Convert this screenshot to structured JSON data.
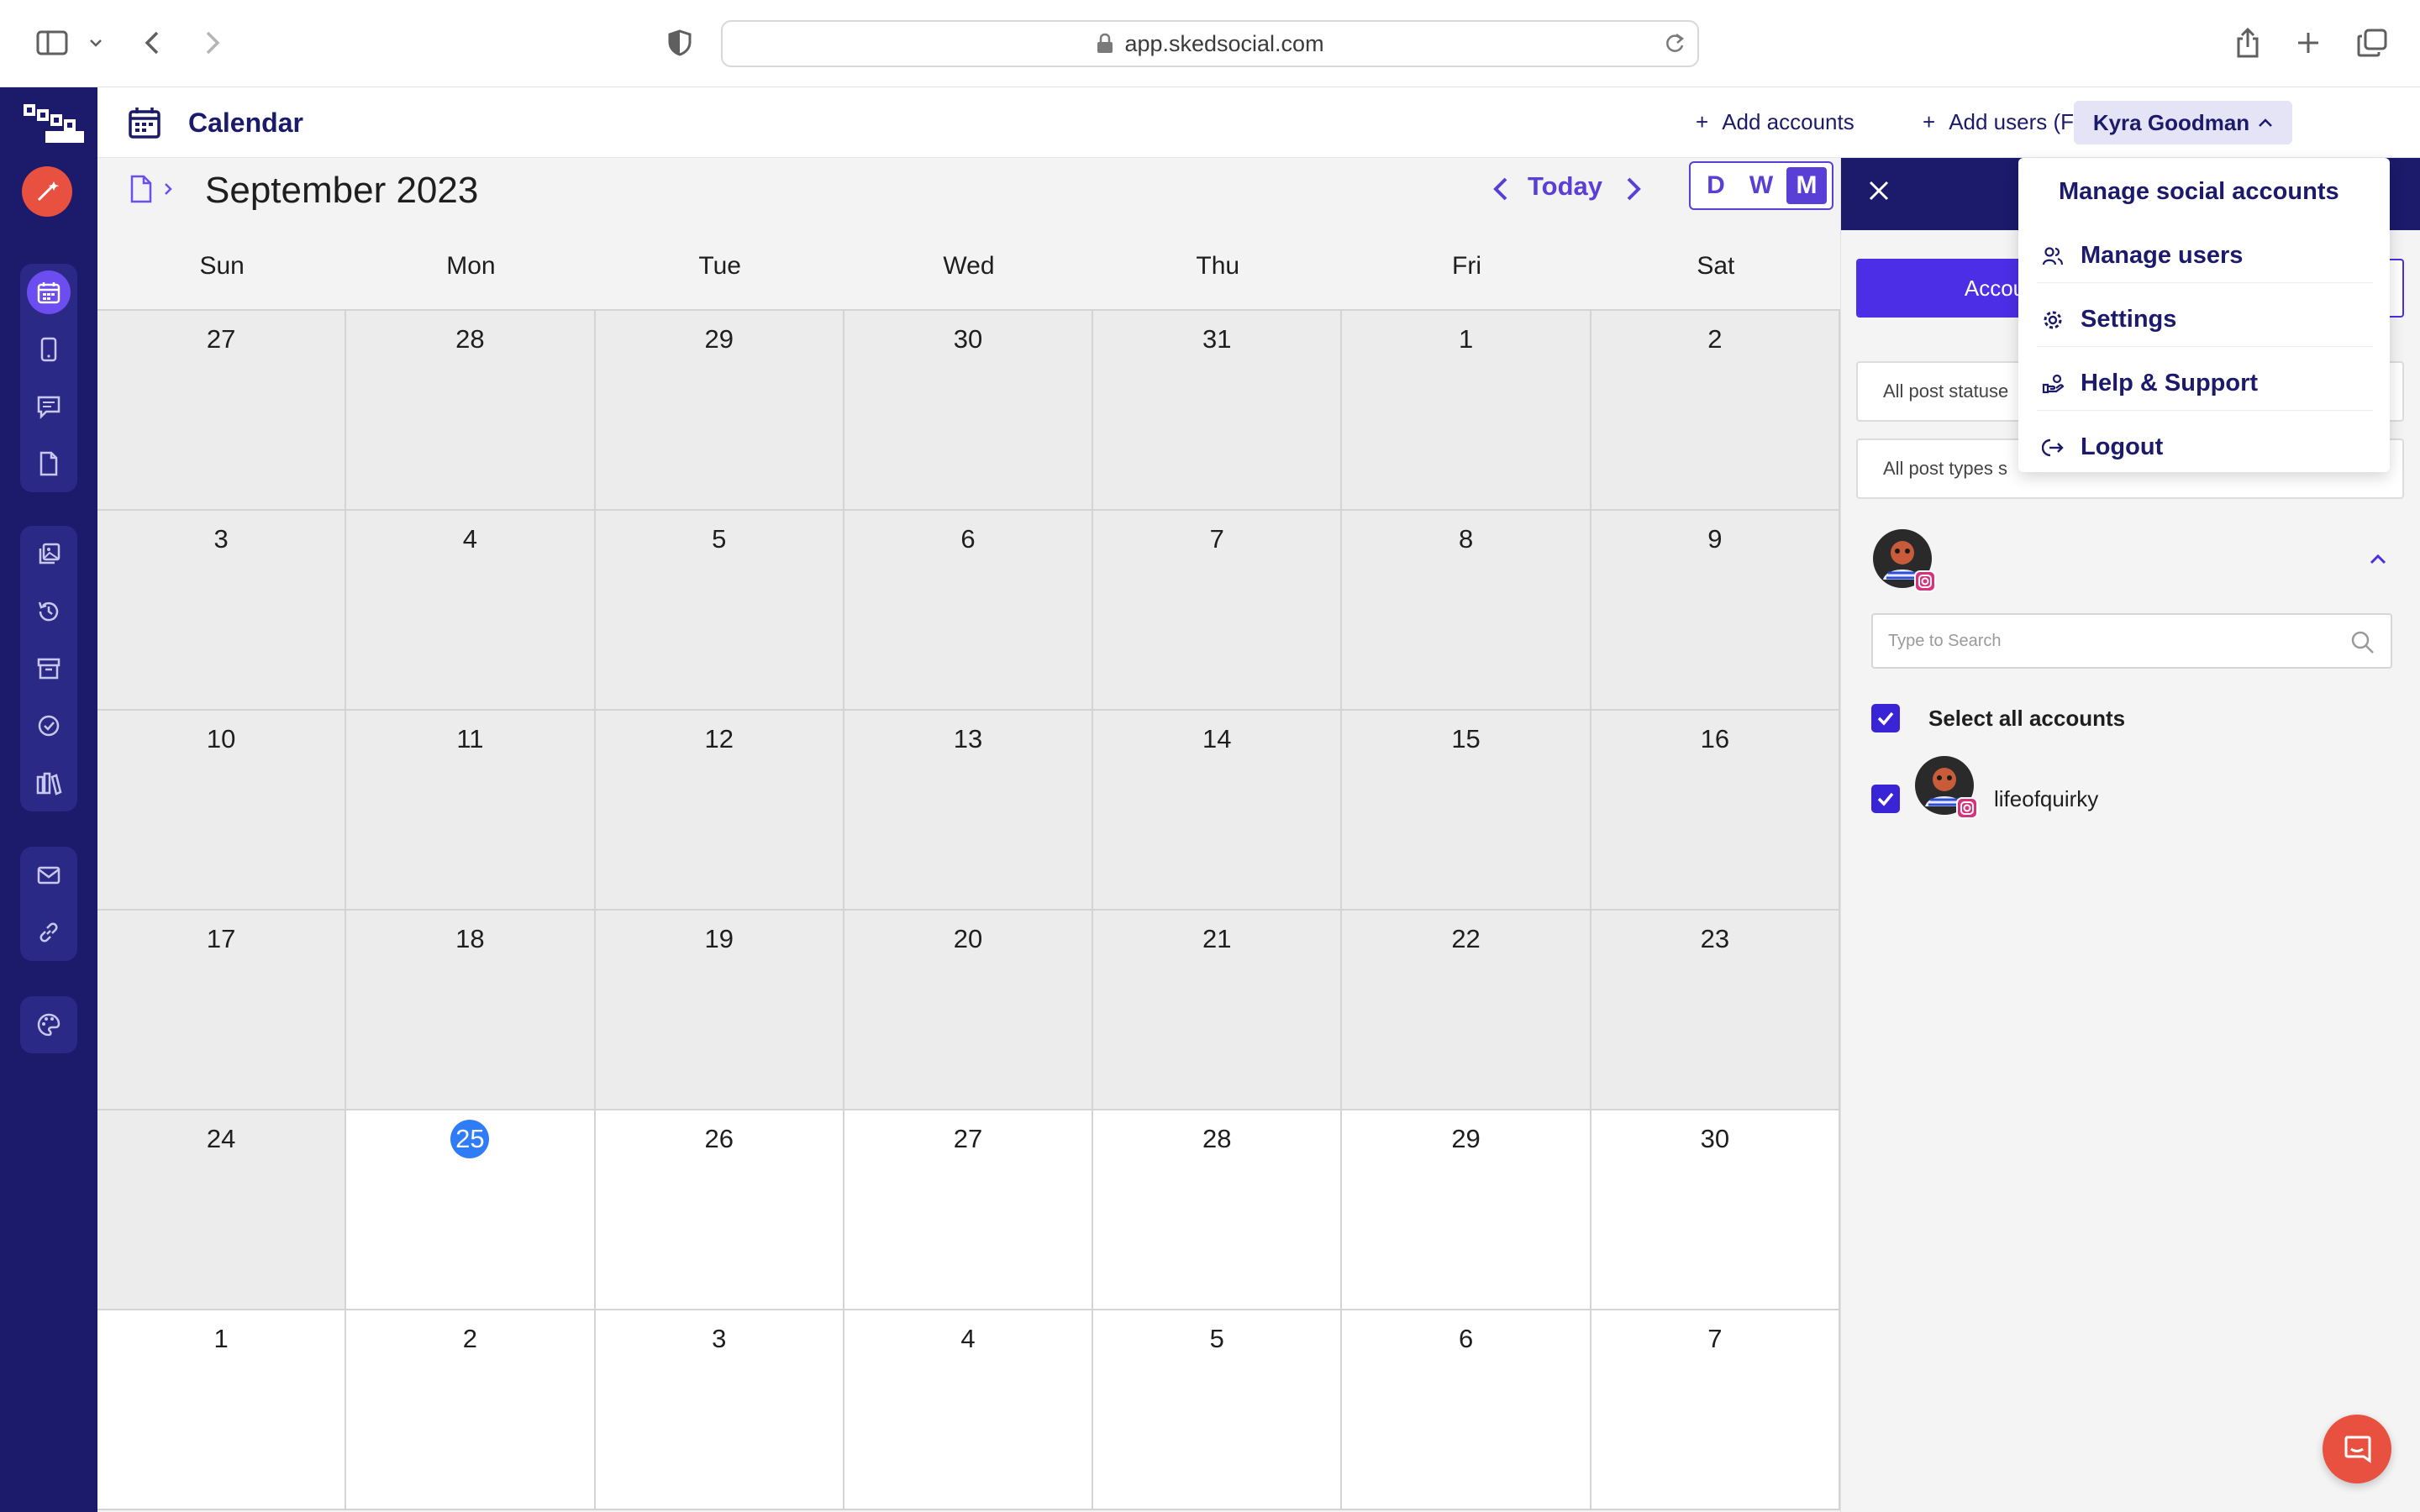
{
  "browser": {
    "url": "app.skedsocial.com"
  },
  "header": {
    "title": "Calendar",
    "add_accounts": "Add accounts",
    "add_users": "Add users (FREE)",
    "user_name": "Kyra Goodman",
    "plus": "+"
  },
  "calendar": {
    "month_title": "September 2023",
    "today_label": "Today",
    "views": {
      "day": "D",
      "week": "W",
      "month": "M",
      "selected": "M"
    },
    "weekdays": [
      "Sun",
      "Mon",
      "Tue",
      "Wed",
      "Thu",
      "Fri",
      "Sat"
    ],
    "weeks": [
      [
        "27",
        "28",
        "29",
        "30",
        "31",
        "1",
        "2"
      ],
      [
        "3",
        "4",
        "5",
        "6",
        "7",
        "8",
        "9"
      ],
      [
        "10",
        "11",
        "12",
        "13",
        "14",
        "15",
        "16"
      ],
      [
        "17",
        "18",
        "19",
        "20",
        "21",
        "22",
        "23"
      ],
      [
        "24",
        "25",
        "26",
        "27",
        "28",
        "29",
        "30"
      ],
      [
        "1",
        "2",
        "3",
        "4",
        "5",
        "6",
        "7"
      ]
    ],
    "today": "25"
  },
  "panel": {
    "tab_label": "Accou",
    "status_filter": "All post statuse",
    "type_filter": "All post types s",
    "search_placeholder": "Type to Search",
    "select_all": "Select all accounts",
    "account_name": "lifeofquirky"
  },
  "menu": {
    "items": [
      {
        "label": "Manage social accounts",
        "icon": "none"
      },
      {
        "label": "Manage users",
        "icon": "users-icon"
      },
      {
        "label": "Settings",
        "icon": "gear-icon"
      },
      {
        "label": "Help & Support",
        "icon": "support-icon"
      },
      {
        "label": "Logout",
        "icon": "logout-icon"
      }
    ]
  },
  "colors": {
    "brand_navy": "#1b1a6b",
    "accent_purple": "#4b2ee6",
    "today_blue": "#2f7cf6",
    "compose_red": "#e8503f"
  }
}
